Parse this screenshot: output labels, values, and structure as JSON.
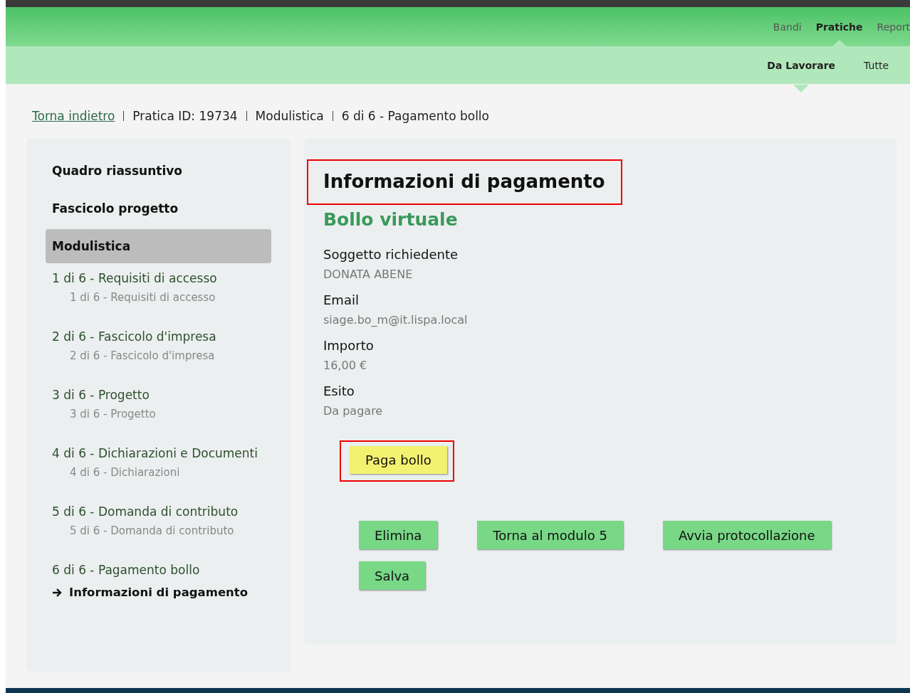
{
  "top_nav": [
    {
      "label": "Bandi",
      "selected": false
    },
    {
      "label": "Pratiche",
      "selected": true
    },
    {
      "label": "Report",
      "selected": false
    }
  ],
  "sub_nav": [
    {
      "label": "Da Lavorare",
      "selected": true
    },
    {
      "label": "Tutte",
      "selected": false
    }
  ],
  "breadcrumb": [
    {
      "label": "Torna indietro",
      "kind": "link"
    },
    {
      "label": "Pratica ID: 19734",
      "kind": "text"
    },
    {
      "label": "Modulistica",
      "kind": "text"
    },
    {
      "label": "6 di 6 - Pagamento bollo",
      "kind": "text"
    }
  ],
  "sidebar": {
    "items": [
      {
        "label": "Quadro riassuntivo",
        "kind": "section",
        "selected": false
      },
      {
        "label": "Fascicolo progetto",
        "kind": "section",
        "selected": false
      },
      {
        "label": "Modulistica",
        "kind": "section",
        "selected": true
      },
      {
        "label": "1 di 6 - Requisiti di accesso",
        "kind": "step"
      },
      {
        "label": "1 di 6 - Requisiti di accesso",
        "kind": "sub"
      },
      {
        "label": "2 di 6 - Fascicolo d'impresa",
        "kind": "step"
      },
      {
        "label": "2 di 6 - Fascicolo d'impresa",
        "kind": "sub"
      },
      {
        "label": "3 di 6 - Progetto",
        "kind": "step"
      },
      {
        "label": "3 di 6 - Progetto",
        "kind": "sub"
      },
      {
        "label": "4 di 6 - Dichiarazioni e Documenti",
        "kind": "step"
      },
      {
        "label": "4 di 6 - Dichiarazioni",
        "kind": "sub"
      },
      {
        "label": "5 di 6 - Domanda di contributo",
        "kind": "step"
      },
      {
        "label": "5 di 6 - Domanda di contributo",
        "kind": "sub"
      },
      {
        "label": "6 di 6 - Pagamento bollo",
        "kind": "step"
      },
      {
        "label": "Informazioni di pagamento",
        "kind": "current",
        "selected": true
      }
    ]
  },
  "main": {
    "title": "Informazioni di pagamento",
    "title_highlighted": true,
    "subtitle": "Bollo virtuale",
    "fields": [
      {
        "label": "Soggetto richiedente",
        "value": "DONATA ABENE"
      },
      {
        "label": "Email",
        "value": "siage.bo_m@it.lispa.local"
      },
      {
        "label": "Importo",
        "value": "16,00 €"
      },
      {
        "label": "Esito",
        "value": "Da pagare"
      }
    ],
    "pay_button": {
      "label": "Paga bollo",
      "highlighted": true
    },
    "actions": [
      "Elimina",
      "Torna al modulo 5",
      "Avvia protocollazione",
      "Salva"
    ]
  }
}
